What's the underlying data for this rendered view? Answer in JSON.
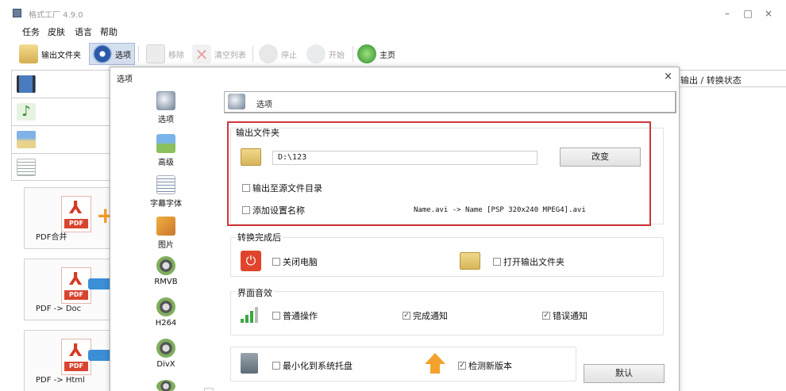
{
  "window": {
    "title": "格式工厂 4.9.0",
    "controls": {
      "minimize": "–",
      "maximize": "□",
      "close": "×"
    }
  },
  "menu": [
    "任务",
    "皮肤",
    "语言",
    "帮助"
  ],
  "toolbar": {
    "output_folder": "输出文件夹",
    "options": "选项",
    "remove": "移除",
    "clear_list": "清空列表",
    "stop": "停止",
    "start": "开始",
    "home": "主页"
  },
  "tiles": [
    "PDF合并",
    "PDF -> Doc",
    "PDF -> Html"
  ],
  "pdf_badge": "PDF",
  "right_panel": {
    "header": "输出 / 转换状态"
  },
  "dialog": {
    "title": "选项",
    "close": "×",
    "nav": [
      "选项",
      "高级",
      "字幕字体",
      "图片",
      "RMVB",
      "H264",
      "DivX"
    ],
    "header": "选项",
    "output_group": {
      "title": "输出文件夹",
      "path": "D:\\123",
      "change": "改变",
      "to_source": "输出至源文件目录",
      "add_setting_name": "添加设置名称",
      "example": "Name.avi  -> Name [PSP 320x240 MPEG4].avi"
    },
    "after_group": {
      "title": "转换完成后",
      "shutdown": "关闭电脑",
      "open_folder": "打开输出文件夹"
    },
    "sound_group": {
      "title": "界面音效",
      "normal": "普通操作",
      "done": "完成通知",
      "error": "错误通知"
    },
    "misc": {
      "minimize_tray": "最小化到系统托盘",
      "check_update": "检测新版本"
    },
    "default_btn": "默认"
  },
  "colors": {
    "highlight": "#d0363a",
    "selected_tab": "#d4dfef"
  }
}
